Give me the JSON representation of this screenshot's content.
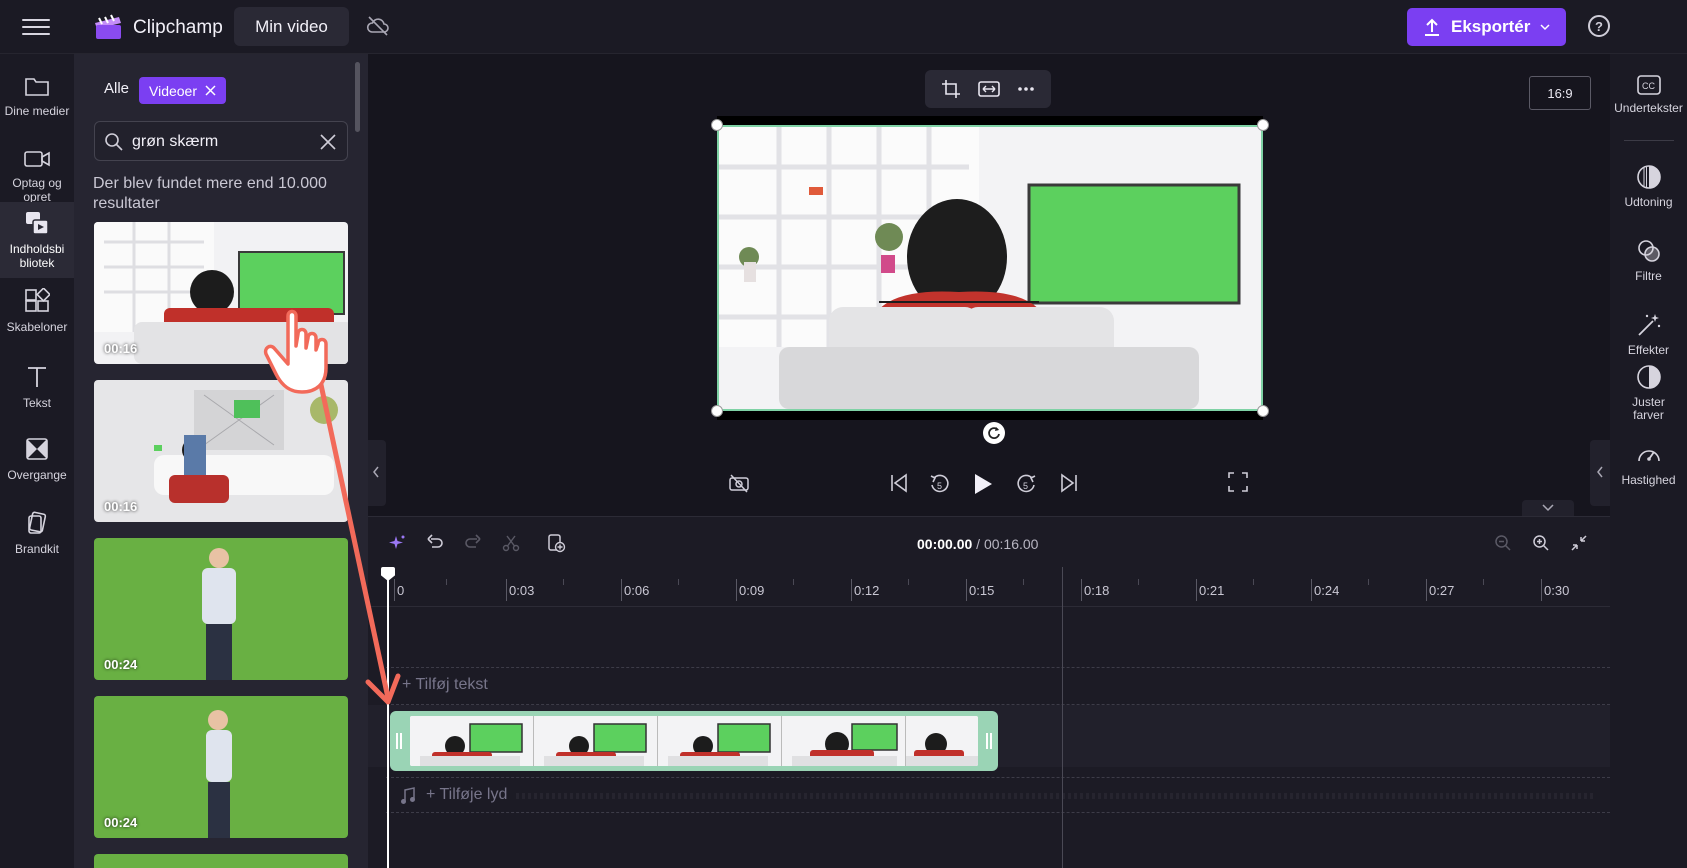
{
  "app": {
    "brand": "Clipchamp",
    "project_title": "Min video",
    "export_label": "Eksportér",
    "help_label": "?"
  },
  "left_rail": [
    {
      "label": "Dine medier",
      "icon": "folder-icon"
    },
    {
      "label": "Optag og opret",
      "icon": "camera-icon"
    },
    {
      "label": "Indholdsbi bliotek",
      "icon": "content-library-icon"
    },
    {
      "label": "Skabeloner",
      "icon": "templates-icon"
    },
    {
      "label": "Tekst",
      "icon": "text-icon"
    },
    {
      "label": "Overgange",
      "icon": "transitions-icon"
    },
    {
      "label": "Brandkit",
      "icon": "brandkit-icon"
    }
  ],
  "media_panel": {
    "filter_all": "Alle",
    "filter_active": "Videoer",
    "search_value": "grøn skærm",
    "results_text": "Der blev fundet mere end 10.000 resultater",
    "thumbnails": [
      {
        "duration": "00:16"
      },
      {
        "duration": "00:16"
      },
      {
        "duration": "00:24"
      },
      {
        "duration": "00:24"
      }
    ]
  },
  "preview": {
    "aspect_ratio": "16:9"
  },
  "right_rail": [
    {
      "label": "Undertekster",
      "icon": "captions-icon"
    },
    {
      "label": "Udtoning",
      "icon": "fade-icon"
    },
    {
      "label": "Filtre",
      "icon": "filters-icon"
    },
    {
      "label": "Effekter",
      "icon": "effects-icon"
    },
    {
      "label": "Juster farver",
      "icon": "adjust-colors-icon"
    },
    {
      "label": "Hastighed",
      "icon": "speed-icon"
    }
  ],
  "timeline": {
    "current_time": "00:00.00",
    "separator": " / ",
    "total_time": "00:16.00",
    "ruler_ticks": [
      "0",
      "0:03",
      "0:06",
      "0:09",
      "0:12",
      "0:15",
      "0:18",
      "0:21",
      "0:24",
      "0:27",
      "0:30"
    ],
    "add_text_label": "+ Tilføj tekst",
    "add_audio_label": "+ Tilføje lyd"
  },
  "colors": {
    "accent": "#7b3ff2",
    "clip_border": "#9ad4b5",
    "background": "#1b1a24"
  }
}
